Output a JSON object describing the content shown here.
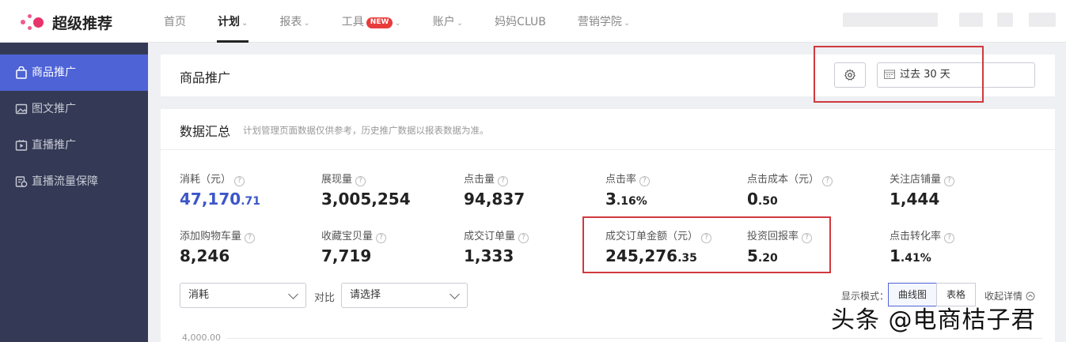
{
  "app": {
    "logo_text": "超级推荐"
  },
  "nav": {
    "items": [
      {
        "label": "首页",
        "chevron": ""
      },
      {
        "label": "计划",
        "chevron": "⌄"
      },
      {
        "label": "报表",
        "chevron": "⌄"
      },
      {
        "label": "工具",
        "badge": "NEW",
        "chevron": "⌄"
      },
      {
        "label": "账户",
        "chevron": "⌄"
      },
      {
        "label": "妈妈CLUB",
        "chevron": ""
      },
      {
        "label": "营销学院",
        "chevron": "⌄"
      }
    ],
    "active_index": 1
  },
  "sidebar": {
    "items": [
      {
        "label": "商品推广",
        "icon": "bag-icon"
      },
      {
        "label": "图文推广",
        "icon": "image-icon"
      },
      {
        "label": "直播推广",
        "icon": "video-icon"
      },
      {
        "label": "直播流量保障",
        "icon": "shield-doc-icon"
      }
    ],
    "active_index": 0
  },
  "header": {
    "title": "商品推广",
    "date_range": "过去 30 天"
  },
  "summary": {
    "title": "数据汇总",
    "note": "计划管理页面数据仅供参考，历史推广数据以报表数据为准。",
    "metrics": [
      {
        "label": "消耗（元）",
        "int": "47,170",
        "dec": ".71",
        "highlight": true
      },
      {
        "label": "展现量",
        "int": "3,005,254",
        "dec": ""
      },
      {
        "label": "点击量",
        "int": "94,837",
        "dec": ""
      },
      {
        "label": "点击率",
        "int": "3",
        "dec": ".16%"
      },
      {
        "label": "点击成本（元）",
        "int": "0",
        "dec": ".50"
      },
      {
        "label": "关注店铺量",
        "int": "1,444",
        "dec": ""
      },
      {
        "label": "添加购物车量",
        "int": "8,246",
        "dec": ""
      },
      {
        "label": "收藏宝贝量",
        "int": "7,719",
        "dec": ""
      },
      {
        "label": "成交订单量",
        "int": "1,333",
        "dec": ""
      },
      {
        "label": "成交订单金额（元）",
        "int": "245,276",
        "dec": ".35"
      },
      {
        "label": "投资回报率",
        "int": "5",
        "dec": ".20"
      },
      {
        "label": "点击转化率",
        "int": "1",
        "dec": ".41%"
      }
    ]
  },
  "controls": {
    "metric_select": "消耗",
    "compare_label": "对比",
    "compare_select": "请选择",
    "mode_label": "显示模式：",
    "mode_chart": "曲线图",
    "mode_table": "表格",
    "collapse": "收起详情"
  },
  "chart": {
    "y_top_label": "4,000.00"
  },
  "watermark": "头条 @电商桔子君",
  "colors": {
    "accent": "#4e63d6",
    "sidebar_bg": "#343a55",
    "highlight_box": "#d0393e",
    "badge": "#e93b3b"
  }
}
